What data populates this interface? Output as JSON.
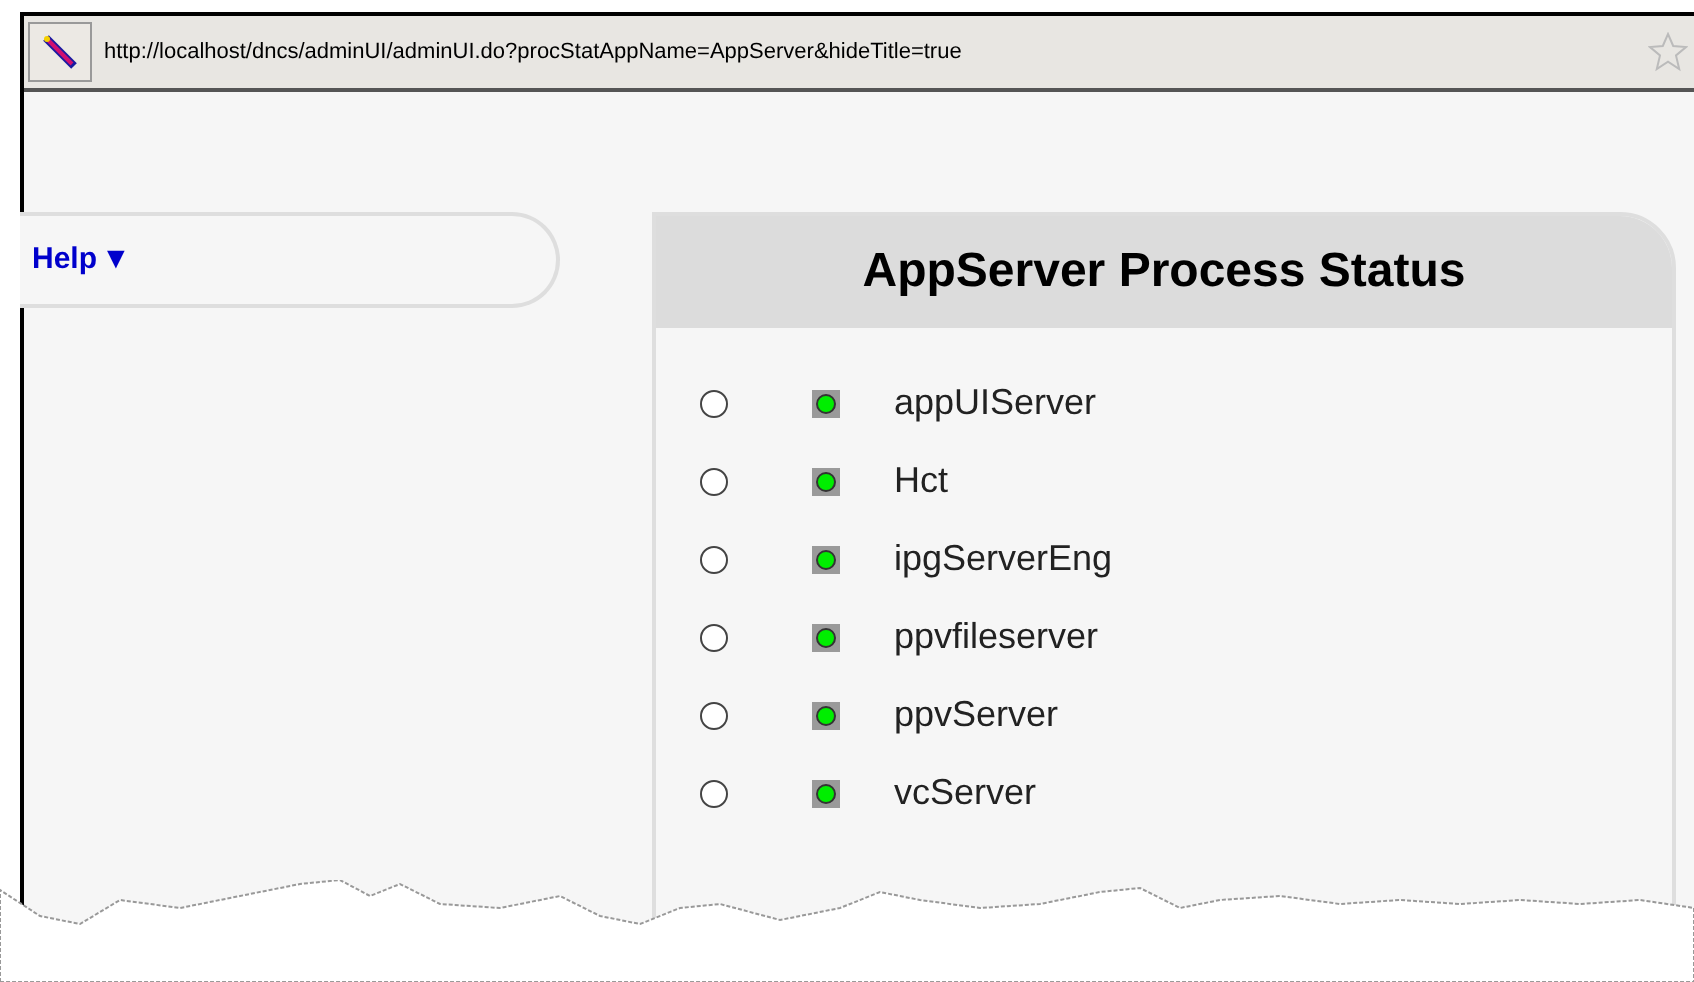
{
  "address_bar": {
    "url": "http://localhost/dncs/adminUI/adminUI.do?procStatAppName=AppServer&hideTitle=true"
  },
  "menu": {
    "label": "Help",
    "arrow": "▼"
  },
  "panel": {
    "title": "AppServer Process Status",
    "processes": [
      {
        "name": "appUIServer",
        "selected": false,
        "running": true
      },
      {
        "name": "Hct",
        "selected": false,
        "running": true
      },
      {
        "name": "ipgServerEng",
        "selected": false,
        "running": true
      },
      {
        "name": "ppvfileserver",
        "selected": false,
        "running": true
      },
      {
        "name": "ppvServer",
        "selected": false,
        "running": true
      },
      {
        "name": "vcServer",
        "selected": false,
        "running": true
      }
    ]
  }
}
